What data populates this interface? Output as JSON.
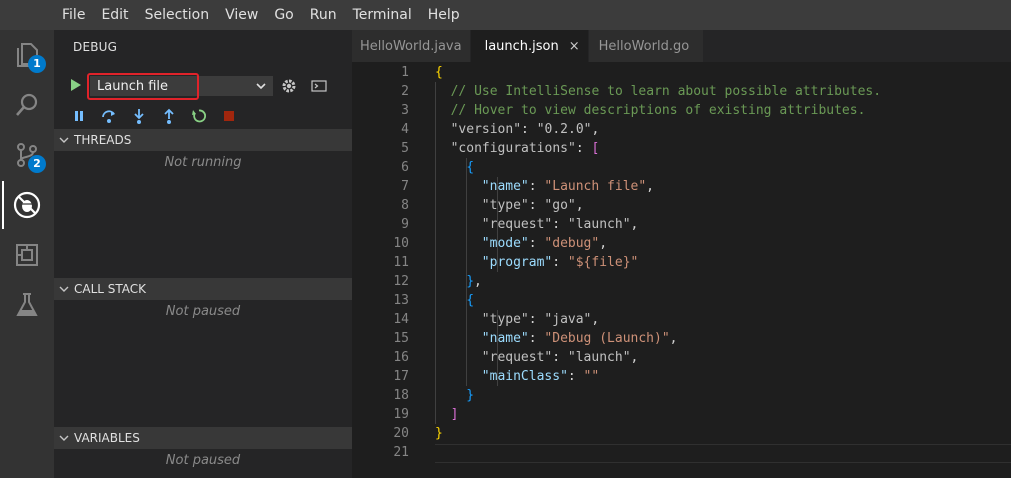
{
  "menu": [
    "File",
    "Edit",
    "Selection",
    "View",
    "Go",
    "Run",
    "Terminal",
    "Help"
  ],
  "activity": {
    "explorer_badge": "1",
    "scm_badge": "2"
  },
  "sidebar": {
    "title": "DEBUG",
    "config_value": "Launch file",
    "sections": [
      {
        "label": "THREADS",
        "empty": "Not running"
      },
      {
        "label": "CALL STACK",
        "empty": "Not paused"
      },
      {
        "label": "VARIABLES",
        "empty": "Not paused"
      }
    ]
  },
  "tabs": [
    {
      "label": "HelloWorld.java",
      "active": false
    },
    {
      "label": "launch.json",
      "active": true,
      "close": "×"
    },
    {
      "label": "HelloWorld.go",
      "active": false
    }
  ],
  "editor": {
    "line_numbers": [
      "1",
      "2",
      "3",
      "4",
      "5",
      "6",
      "7",
      "8",
      "9",
      "10",
      "11",
      "12",
      "13",
      "14",
      "15",
      "16",
      "17",
      "18",
      "19",
      "20",
      "21"
    ],
    "lines": [
      {
        "ind": 0,
        "tokens": [
          [
            "brace",
            "{"
          ]
        ]
      },
      {
        "ind": 1,
        "tokens": [
          [
            "comment",
            "// Use IntelliSense to learn about possible attributes."
          ]
        ]
      },
      {
        "ind": 1,
        "tokens": [
          [
            "comment",
            "// Hover to view descriptions of existing attributes."
          ]
        ]
      },
      {
        "ind": 1,
        "tokens": [
          [
            "key-dim",
            "\"version\""
          ],
          [
            "punc",
            ": "
          ],
          [
            "str-dim",
            "\"0.2.0\""
          ],
          [
            "punc",
            ","
          ]
        ]
      },
      {
        "ind": 1,
        "tokens": [
          [
            "key-dim",
            "\"configurations\""
          ],
          [
            "punc",
            ": "
          ],
          [
            "bracket",
            "["
          ]
        ]
      },
      {
        "ind": 2,
        "tokens": [
          [
            "brace2",
            "{"
          ]
        ]
      },
      {
        "ind": 3,
        "tokens": [
          [
            "key",
            "\"name\""
          ],
          [
            "punc",
            ": "
          ],
          [
            "str",
            "\"Launch file\""
          ],
          [
            "punc",
            ","
          ]
        ]
      },
      {
        "ind": 3,
        "tokens": [
          [
            "key-dim",
            "\"type\""
          ],
          [
            "punc",
            ": "
          ],
          [
            "str-dim",
            "\"go\""
          ],
          [
            "punc",
            ","
          ]
        ]
      },
      {
        "ind": 3,
        "tokens": [
          [
            "key-dim",
            "\"request\""
          ],
          [
            "punc",
            ": "
          ],
          [
            "str-dim",
            "\"launch\""
          ],
          [
            "punc",
            ","
          ]
        ]
      },
      {
        "ind": 3,
        "tokens": [
          [
            "key",
            "\"mode\""
          ],
          [
            "punc",
            ": "
          ],
          [
            "str",
            "\"debug\""
          ],
          [
            "punc",
            ","
          ]
        ]
      },
      {
        "ind": 3,
        "tokens": [
          [
            "key",
            "\"program\""
          ],
          [
            "punc",
            ": "
          ],
          [
            "str",
            "\"${file}\""
          ]
        ]
      },
      {
        "ind": 2,
        "tokens": [
          [
            "brace2",
            "}"
          ],
          [
            "punc",
            ","
          ]
        ]
      },
      {
        "ind": 2,
        "tokens": [
          [
            "brace2",
            "{"
          ]
        ]
      },
      {
        "ind": 3,
        "tokens": [
          [
            "key-dim",
            "\"type\""
          ],
          [
            "punc",
            ": "
          ],
          [
            "str-dim",
            "\"java\""
          ],
          [
            "punc",
            ","
          ]
        ]
      },
      {
        "ind": 3,
        "tokens": [
          [
            "key",
            "\"name\""
          ],
          [
            "punc",
            ": "
          ],
          [
            "str",
            "\"Debug (Launch)\""
          ],
          [
            "punc",
            ","
          ]
        ]
      },
      {
        "ind": 3,
        "tokens": [
          [
            "key-dim",
            "\"request\""
          ],
          [
            "punc",
            ": "
          ],
          [
            "str-dim",
            "\"launch\""
          ],
          [
            "punc",
            ","
          ]
        ]
      },
      {
        "ind": 3,
        "tokens": [
          [
            "key",
            "\"mainClass\""
          ],
          [
            "punc",
            ": "
          ],
          [
            "str",
            "\"\""
          ]
        ]
      },
      {
        "ind": 2,
        "tokens": [
          [
            "brace2",
            "}"
          ]
        ]
      },
      {
        "ind": 1,
        "tokens": [
          [
            "bracket",
            "]"
          ]
        ]
      },
      {
        "ind": 0,
        "tokens": [
          [
            "brace",
            "}"
          ]
        ]
      },
      {
        "ind": 0,
        "tokens": []
      }
    ]
  },
  "colors": {
    "accent": "#007acc",
    "highlight_box": "#e0232a",
    "play": "#89d185",
    "debug_action": "#75beff",
    "restart": "#89d185",
    "stop": "#a1260d"
  }
}
